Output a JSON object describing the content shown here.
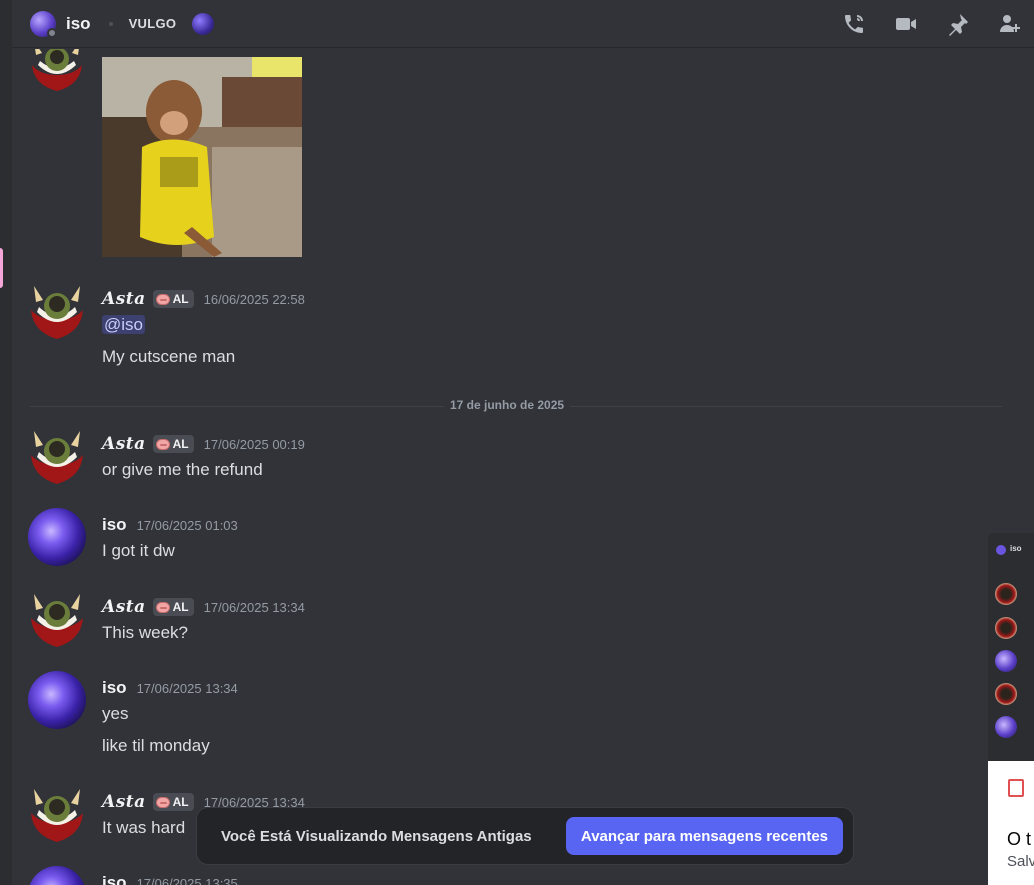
{
  "header": {
    "dm_name": "iso",
    "server_tag": "VULGO",
    "tools": [
      {
        "name": "voice-call-icon"
      },
      {
        "name": "video-call-icon"
      },
      {
        "name": "pinned-messages-icon"
      },
      {
        "name": "add-friends-icon"
      }
    ]
  },
  "divider": {
    "label": "17 de junho de 2025"
  },
  "messages": [
    {
      "author": "Asta",
      "tag": "AL",
      "timestamp": "16/06/2025 22:58",
      "lines": [
        "@iso",
        "My cutscene man"
      ]
    },
    {
      "author": "Asta",
      "tag": "AL",
      "timestamp": "17/06/2025 00:19",
      "lines": [
        "or give me the refund"
      ]
    },
    {
      "author": "iso",
      "timestamp": "17/06/2025 01:03",
      "lines": [
        "I got it dw"
      ]
    },
    {
      "author": "Asta",
      "tag": "AL",
      "timestamp": "17/06/2025 13:34",
      "lines": [
        "This week?"
      ]
    },
    {
      "author": "iso",
      "timestamp": "17/06/2025 13:34",
      "lines": [
        "yes",
        "like til monday"
      ]
    },
    {
      "author": "Asta",
      "tag": "AL",
      "timestamp": "17/06/2025 13:34",
      "lines": [
        "It was hard"
      ]
    },
    {
      "author": "iso",
      "timestamp": "17/06/2025 13:35",
      "lines": []
    }
  ],
  "jump_bar": {
    "text": "Você Está Visualizando Mensagens Antigas",
    "button_label": "Avançar para mensagens recentes"
  },
  "popout": {
    "title": "iso",
    "bottom_line_1": "O t",
    "bottom_line_2": "Salv"
  },
  "colors": {
    "background": "#313338",
    "accent": "#5865f2",
    "mention_bg": "rgba(88,101,242,0.3)",
    "timestamp": "#949ba4"
  }
}
